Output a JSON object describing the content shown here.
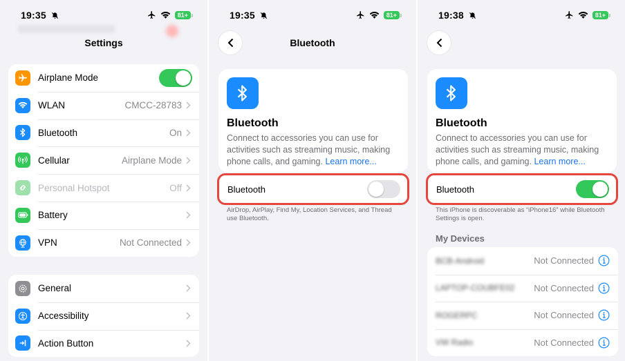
{
  "panel1": {
    "status": {
      "time": "19:35",
      "battery": "81+"
    },
    "title": "Settings",
    "group1": [
      {
        "label": "Airplane Mode",
        "value": "",
        "toggle": "on",
        "icon": "airplane-icon",
        "color": "#ff9500"
      },
      {
        "label": "WLAN",
        "value": "CMCC-28783",
        "icon": "wifi-icon",
        "color": "#1a8cff"
      },
      {
        "label": "Bluetooth",
        "value": "On",
        "icon": "bluetooth-icon",
        "color": "#1a8cff"
      },
      {
        "label": "Cellular",
        "value": "Airplane Mode",
        "icon": "antenna-icon",
        "color": "#34c759"
      },
      {
        "label": "Personal Hotspot",
        "value": "Off",
        "icon": "hotspot-icon",
        "color": "#9fe0ad",
        "dim": true
      },
      {
        "label": "Battery",
        "value": "",
        "icon": "battery-icon",
        "color": "#34c759"
      },
      {
        "label": "VPN",
        "value": "Not Connected",
        "icon": "globe-icon",
        "color": "#1a8cff"
      }
    ],
    "group2": [
      {
        "label": "General",
        "icon": "gear-icon",
        "color": "#8e8e93"
      },
      {
        "label": "Accessibility",
        "icon": "accessibility-icon",
        "color": "#1a8cff"
      },
      {
        "label": "Action Button",
        "icon": "action-button-icon",
        "color": "#1a8cff"
      }
    ]
  },
  "panel2": {
    "status": {
      "time": "19:35",
      "battery": "81+"
    },
    "title": "Bluetooth",
    "heading": "Bluetooth",
    "description": "Connect to accessories you can use for activities such as streaming music, making phone calls, and gaming.",
    "learn_more": "Learn more...",
    "toggle_label": "Bluetooth",
    "toggle": "off",
    "footnote": "AirDrop, AirPlay, Find My, Location Services, and Thread use Bluetooth."
  },
  "panel3": {
    "status": {
      "time": "19:38",
      "battery": "81+"
    },
    "heading": "Bluetooth",
    "description": "Connect to accessories you can use for activities such as streaming music, making phone calls, and gaming.",
    "learn_more": "Learn more...",
    "toggle_label": "Bluetooth",
    "toggle": "on",
    "footnote": "This iPhone is discoverable as “iPhone16” while Bluetooth Settings is open.",
    "devices_header": "My Devices",
    "devices": [
      {
        "name": "BCB-Android",
        "status": "Not Connected"
      },
      {
        "name": "LAPTOP-COUBFE02",
        "status": "Not Connected"
      },
      {
        "name": "ROGERPC",
        "status": "Not Connected"
      },
      {
        "name": "VW Radio",
        "status": "Not Connected"
      }
    ]
  },
  "colors": {
    "accent": "#1a8cff",
    "toggle_on": "#34c759",
    "highlight": "#e5463d",
    "link": "#1a73e8"
  }
}
